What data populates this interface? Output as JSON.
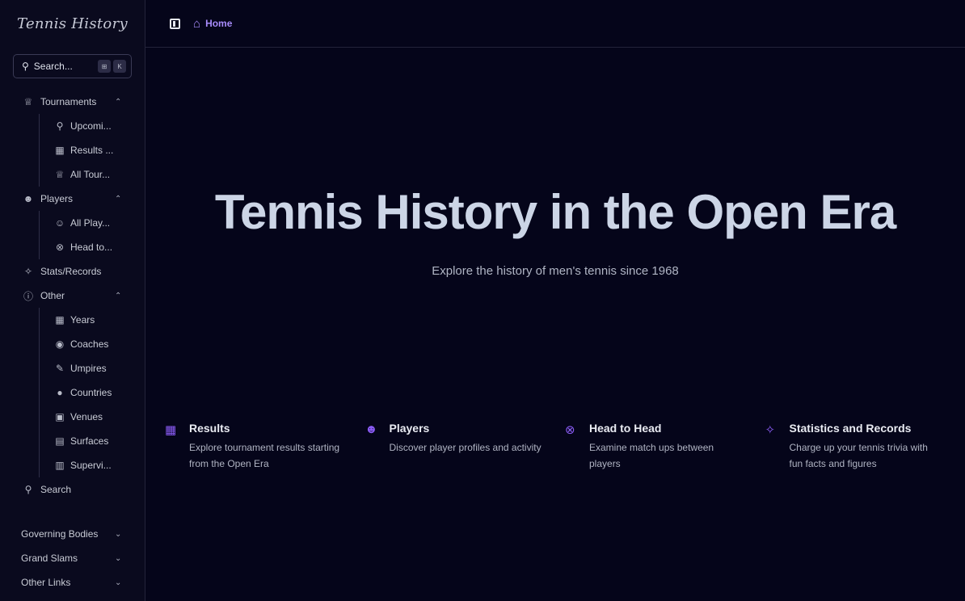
{
  "app": {
    "title": "Tennis History"
  },
  "search": {
    "label": "Search...",
    "kbd1": "⊞",
    "kbd2": "K"
  },
  "sidebar": {
    "tournaments": {
      "label": "Tournaments",
      "items": [
        "Upcomi...",
        "Results ...",
        "All Tour..."
      ]
    },
    "players": {
      "label": "Players",
      "items": [
        "All Play...",
        "Head to..."
      ]
    },
    "stats": {
      "label": "Stats/Records"
    },
    "other": {
      "label": "Other",
      "items": [
        "Years",
        "Coaches",
        "Umpires",
        "Countries",
        "Venues",
        "Surfaces",
        "Supervi..."
      ]
    },
    "search": {
      "label": "Search"
    },
    "bottom": [
      "Governing Bodies",
      "Grand Slams",
      "Other Links"
    ]
  },
  "breadcrumb": {
    "home": "Home"
  },
  "hero": {
    "title": "Tennis History in the Open Era",
    "subtitle": "Explore the history of men's tennis since 1968"
  },
  "features": [
    {
      "icon": "calendar-icon",
      "title": "Results",
      "desc": "Explore tournament results starting from the Open Era"
    },
    {
      "icon": "users-icon",
      "title": "Players",
      "desc": "Discover player profiles and activity"
    },
    {
      "icon": "versus-icon",
      "title": "Head to Head",
      "desc": "Examine match ups between players"
    },
    {
      "icon": "sparkle-icon",
      "title": "Statistics and Records",
      "desc": "Charge up your tennis trivia with fun facts and figures"
    }
  ],
  "colors": {
    "accent": "#a78bfa",
    "background": "#05051a",
    "sidebar": "#0a0a1e"
  }
}
